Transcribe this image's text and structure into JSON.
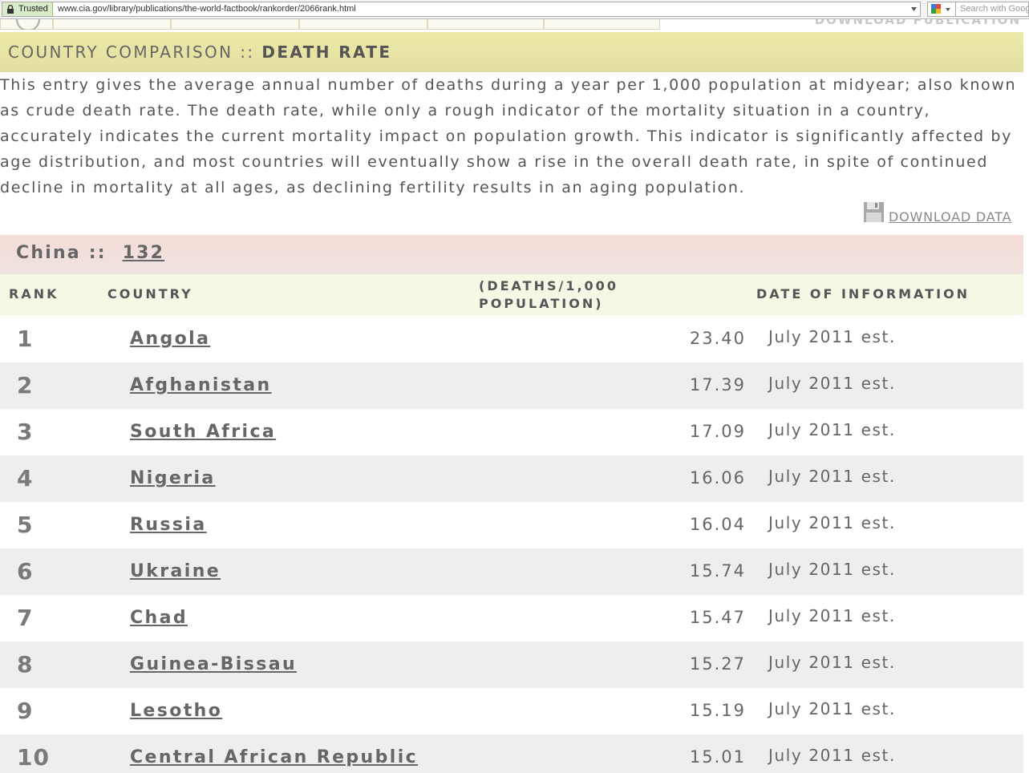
{
  "browser": {
    "trusted_label": "Trusted",
    "url": "www.cia.gov/library/publications/the-world-factbook/rankorder/2066rank.html",
    "search_placeholder": "Search with Google"
  },
  "nav": {
    "download_publication": "DOWNLOAD PUBLICATION"
  },
  "page": {
    "title_prefix": "COUNTRY COMPARISON :: ",
    "title_main": "DEATH RATE",
    "description": "This entry gives the average annual number of deaths during a year per 1,000 population at midyear; also known as crude death rate. The death rate, while only a rough indicator of the mortality situation in a country, accurately indicates the current mortality impact on population growth. This indicator is significantly affected by age distribution, and most countries will eventually show a rise in the overall death rate, in spite of continued decline in mortality at all ages, as declining fertility results in an aging population.",
    "download_data": "DOWNLOAD DATA"
  },
  "selected_country": {
    "name": "China",
    "separator": "::",
    "rank": "132"
  },
  "table": {
    "headers": {
      "rank": "RANK",
      "country": "COUNTRY",
      "value_line1": "(DEATHS/1,000",
      "value_line2": "POPULATION)",
      "date": "DATE OF INFORMATION"
    },
    "rows": [
      {
        "rank": "1",
        "country": "Angola",
        "value": "23.40",
        "date": "July 2011 est."
      },
      {
        "rank": "2",
        "country": "Afghanistan",
        "value": "17.39",
        "date": "July 2011 est."
      },
      {
        "rank": "3",
        "country": "South Africa",
        "value": "17.09",
        "date": "July 2011 est."
      },
      {
        "rank": "4",
        "country": "Nigeria",
        "value": "16.06",
        "date": "July 2011 est."
      },
      {
        "rank": "5",
        "country": "Russia",
        "value": "16.04",
        "date": "July 2011 est."
      },
      {
        "rank": "6",
        "country": "Ukraine",
        "value": "15.74",
        "date": "July 2011 est."
      },
      {
        "rank": "7",
        "country": "Chad",
        "value": "15.47",
        "date": "July 2011 est."
      },
      {
        "rank": "8",
        "country": "Guinea-Bissau",
        "value": "15.27",
        "date": "July 2011 est."
      },
      {
        "rank": "9",
        "country": "Lesotho",
        "value": "15.19",
        "date": "July 2011 est."
      },
      {
        "rank": "10",
        "country": "Central African Republic",
        "value": "15.01",
        "date": "July 2011 est."
      }
    ]
  }
}
